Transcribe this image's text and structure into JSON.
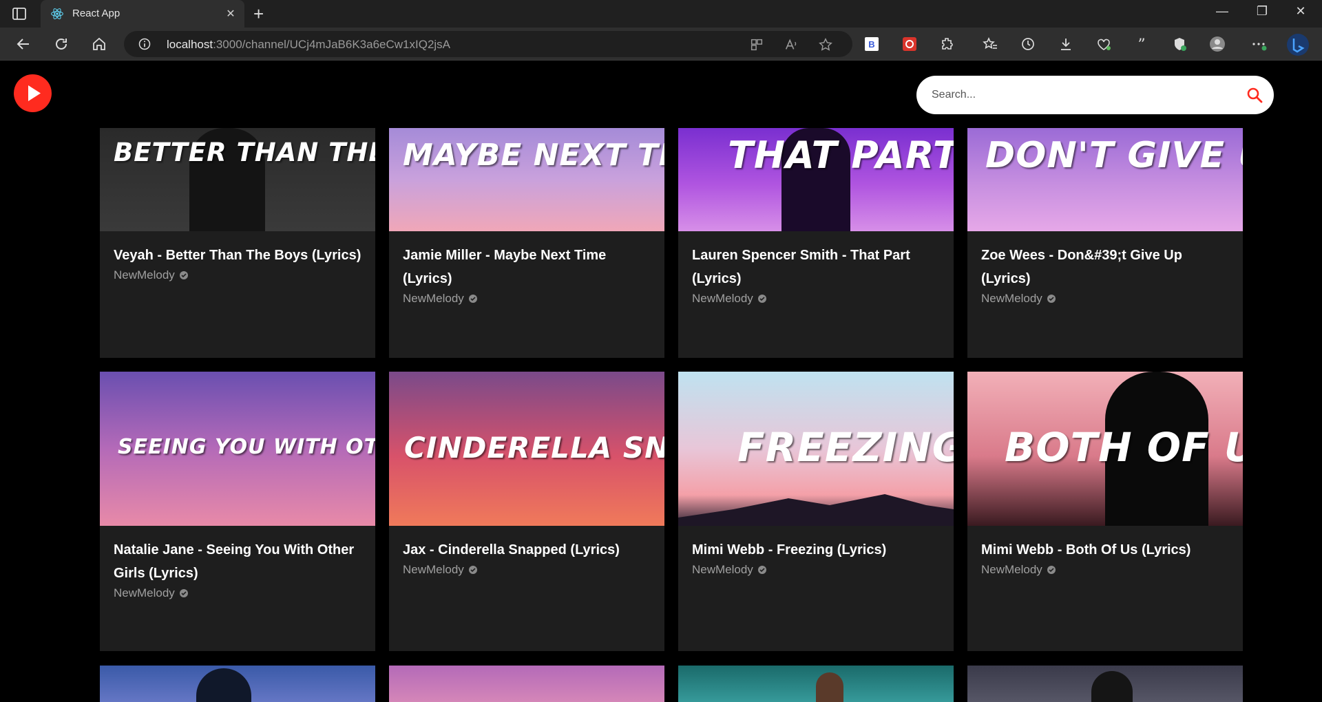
{
  "browser": {
    "tab_title": "React App",
    "url_host": "localhost",
    "url_rest": ":3000/channel/UCj4mJaB6K3a6eCw1xIQ2jsA"
  },
  "search": {
    "placeholder": "Search..."
  },
  "videos": [
    {
      "thumb_text": "BETTER THAN THE BOY",
      "title": "Veyah - Better Than The Boys (Lyrics)",
      "channel": "NewMelody"
    },
    {
      "thumb_text": "MAYBE NEXT TIM",
      "title": "Jamie Miller - Maybe Next Time (Lyrics)",
      "channel": "NewMelody"
    },
    {
      "thumb_text": "THAT PART",
      "title": "Lauren Spencer Smith - That Part (Lyrics)",
      "channel": "NewMelody"
    },
    {
      "thumb_text": "DON'T GIVE UP",
      "title": "Zoe Wees - Don&#39;t Give Up (Lyrics)",
      "channel": "NewMelody"
    },
    {
      "thumb_text": "SEEING YOU WITH OTHER GIRL",
      "title": "Natalie Jane - Seeing You With Other Girls (Lyrics)",
      "channel": "NewMelody"
    },
    {
      "thumb_text": "CINDERELLA SNAPPE",
      "title": "Jax - Cinderella Snapped (Lyrics)",
      "channel": "NewMelody"
    },
    {
      "thumb_text": "FREEZING",
      "title": "Mimi Webb - Freezing (Lyrics)",
      "channel": "NewMelody"
    },
    {
      "thumb_text": "BOTH OF US",
      "title": "Mimi Webb - Both Of Us (Lyrics)",
      "channel": "NewMelody"
    }
  ],
  "colors": {
    "accent": "#ff2b1f",
    "card": "#1e1e1e"
  }
}
